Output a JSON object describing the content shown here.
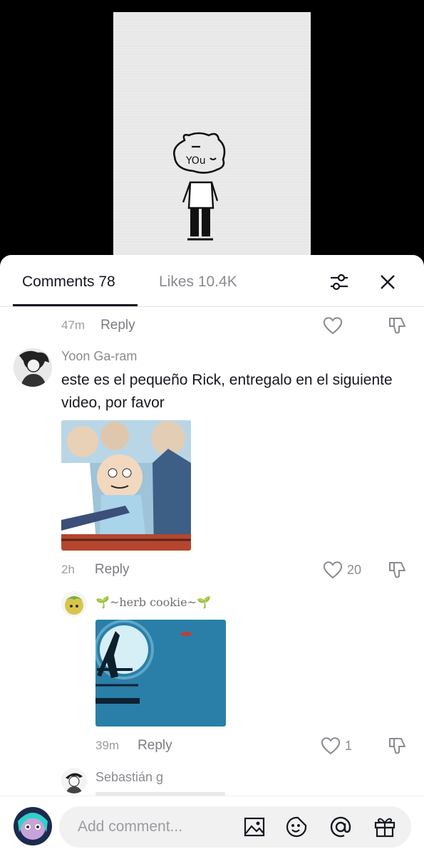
{
  "tabs": {
    "comments_label": "Comments 78",
    "likes_label": "Likes 10.4K"
  },
  "video": {
    "drawing_text": "YOu"
  },
  "comments": [
    {
      "time": "47m",
      "reply_label": "Reply"
    },
    {
      "username": "Yoon Ga-ram",
      "text": "este es el pequeño Rick, entregalo en el siguiente video, por favor",
      "time": "2h",
      "reply_label": "Reply",
      "likes": "20"
    },
    {
      "username": "🌱~herb cookie~🌱",
      "time": "39m",
      "reply_label": "Reply",
      "likes": "1"
    },
    {
      "username": "Sebastián g"
    }
  ],
  "input": {
    "placeholder": "Add comment..."
  },
  "colors": {
    "accent": "#161823",
    "muted": "#8a8b91",
    "sheet_bg": "#ffffff",
    "input_bg": "#f1f1f2"
  }
}
